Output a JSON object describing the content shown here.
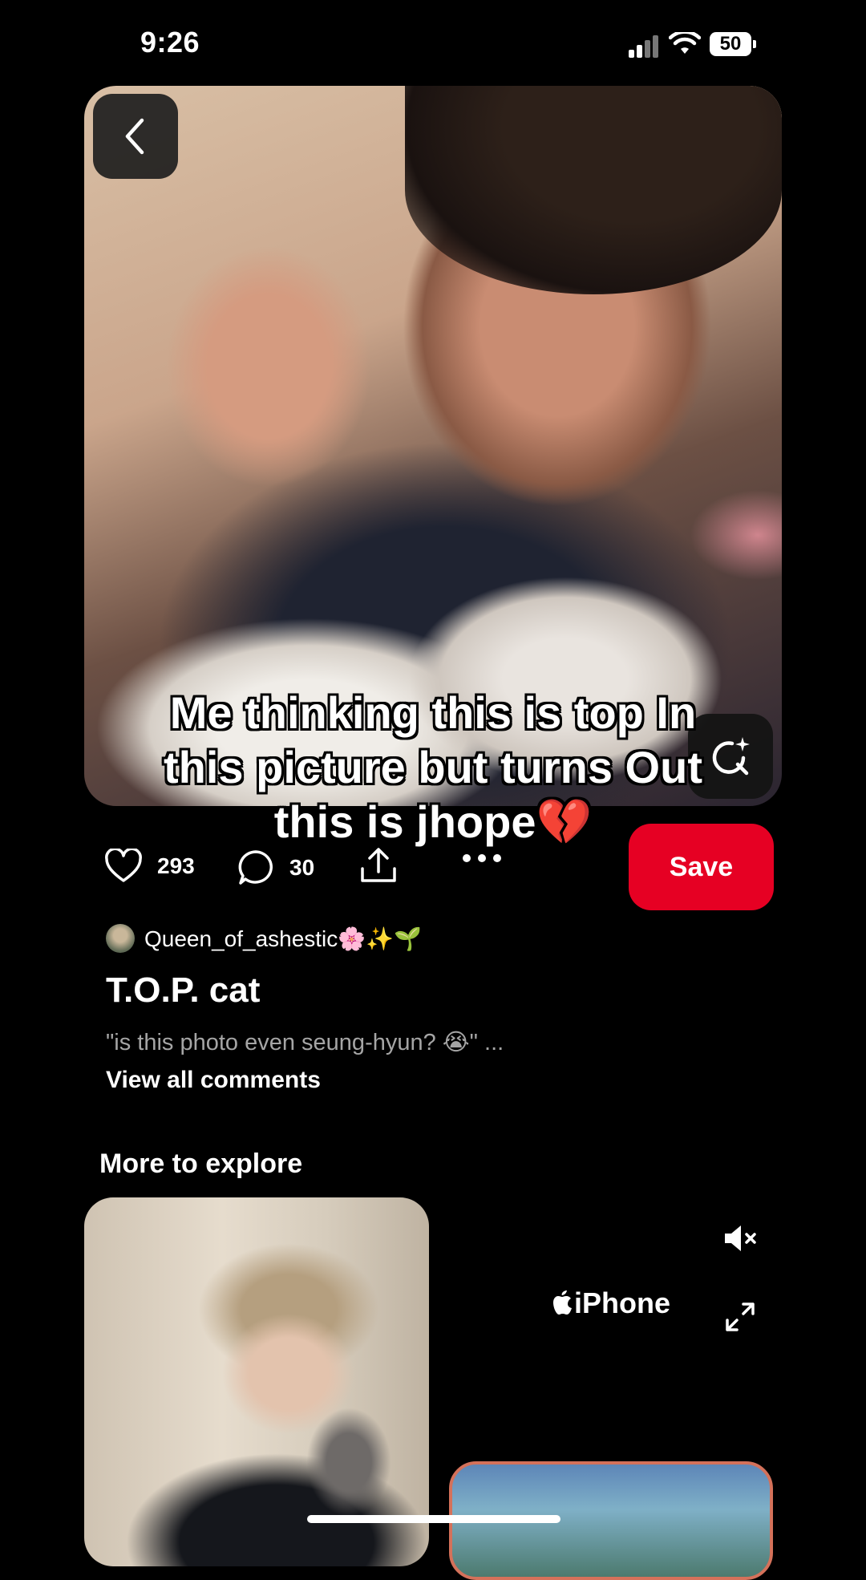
{
  "status": {
    "time": "9:26",
    "battery": "50"
  },
  "pin": {
    "caption": "Me thinking this is top In this picture but turns Out this is jhope💔",
    "likes": "293",
    "comments": "30",
    "save_label": "Save",
    "author": "Queen_of_ashestic🌸✨🌱",
    "title": "T.O.P. cat",
    "comment_preview": "\"is this photo even seung-hyun? 😭\" ...",
    "view_all_comments": "View all comments"
  },
  "explore": {
    "heading": "More to explore",
    "ad_label": "iPhone"
  },
  "icons": {
    "back": "chevron-left-icon",
    "visual_search": "lens-sparkle-icon",
    "like": "heart-icon",
    "comment": "speech-bubble-icon",
    "share": "share-upload-icon",
    "more": "ellipsis-icon",
    "mute": "speaker-muted-icon",
    "expand": "expand-arrows-icon"
  },
  "colors": {
    "save_button": "#e60023",
    "background": "#000000"
  }
}
